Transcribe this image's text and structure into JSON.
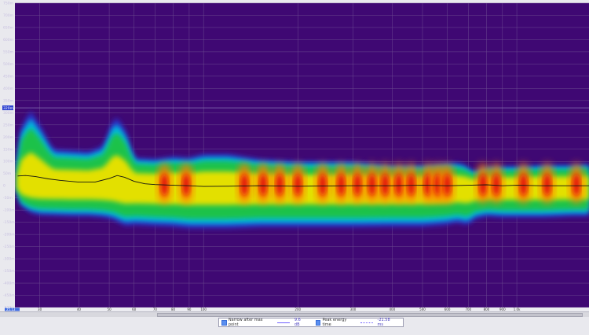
{
  "chart_data": {
    "type": "heatmap",
    "title": "",
    "xlabel": "",
    "ylabel": "",
    "x_scale": "log",
    "xlim": [
      25,
      1700
    ],
    "ylim": [
      -500,
      750
    ],
    "x_ticks": [
      30,
      40,
      50,
      60,
      70,
      80,
      90,
      100,
      200,
      300,
      400,
      500,
      600,
      700,
      800,
      900,
      "1.0k"
    ],
    "x_tick_values": [
      30,
      40,
      50,
      60,
      70,
      80,
      90,
      100,
      200,
      300,
      400,
      500,
      600,
      700,
      800,
      900,
      1000
    ],
    "x_start_label": "25.13",
    "y_ticks": [
      "750m",
      "700m",
      "650m",
      "600m",
      "550m",
      "500m",
      "450m",
      "400m",
      "350m",
      "300m",
      "250m",
      "200m",
      "150m",
      "100m",
      "50m",
      "0",
      "-50m",
      "-100m",
      "-150m",
      "-200m",
      "-250m",
      "-300m",
      "-350m",
      "-400m",
      "-450m",
      "-500m"
    ],
    "y_tick_values": [
      750,
      700,
      650,
      600,
      550,
      500,
      450,
      400,
      350,
      300,
      250,
      200,
      150,
      100,
      50,
      0,
      -50,
      -100,
      -150,
      -200,
      -250,
      -300,
      -350,
      -400,
      -450,
      -500
    ],
    "y_marker_label": "320m",
    "y_marker_value": 320,
    "grid": true,
    "colors": {
      "background": "#3f0873",
      "grid": "#6b4a90",
      "scale": [
        "#3f0873",
        "#2b2ec4",
        "#00b8e0",
        "#1cc24a",
        "#e3e000",
        "#ff7a00",
        "#e01010"
      ]
    },
    "series": [
      {
        "name": "Peak energy time",
        "x": [
          25.5,
          27,
          29,
          32,
          35,
          40,
          45,
          50,
          53,
          56,
          60,
          65,
          70,
          80,
          90,
          100,
          120,
          150,
          200,
          300,
          400,
          500,
          600,
          700,
          800,
          900,
          1000,
          1200,
          1500,
          1700
        ],
        "y": [
          40,
          42,
          38,
          28,
          22,
          15,
          15,
          30,
          42,
          35,
          18,
          8,
          5,
          2,
          0,
          -3,
          -2,
          0,
          -2,
          0,
          0,
          2,
          0,
          2,
          4,
          0,
          2,
          0,
          0,
          0
        ]
      }
    ],
    "energy_envelope": {
      "x": [
        25.3,
        26,
        28,
        30,
        33,
        38,
        43,
        48,
        52,
        56,
        60,
        70,
        80,
        90,
        100,
        120,
        150,
        200,
        300,
        400,
        500,
        600,
        650,
        700,
        720,
        800,
        900,
        1000,
        1200,
        1500,
        1700
      ],
      "upper": [
        90,
        230,
        310,
        250,
        150,
        145,
        140,
        165,
        290,
        240,
        115,
        110,
        120,
        115,
        130,
        130,
        110,
        100,
        100,
        85,
        85,
        95,
        95,
        80,
        55,
        80,
        80,
        80,
        85,
        85,
        90
      ],
      "lower": [
        -20,
        -80,
        -110,
        -120,
        -122,
        -125,
        -125,
        -130,
        -140,
        -165,
        -160,
        -165,
        -168,
        -175,
        -175,
        -175,
        -170,
        -170,
        -170,
        -168,
        -168,
        -160,
        -150,
        -165,
        -140,
        -125,
        -130,
        -130,
        -130,
        -125,
        -125
      ]
    },
    "hotspots_hz": [
      75,
      88,
      135,
      155,
      175,
      200,
      240,
      275,
      310,
      345,
      380,
      420,
      460,
      520,
      560,
      600,
      780,
      860,
      1050,
      1250,
      1550
    ]
  },
  "legend": {
    "item1_label": "Narrow after  max point",
    "item1_value": "9.6 dB",
    "item2_label": "Peak energy time",
    "item2_value": "-21.58 ms"
  }
}
